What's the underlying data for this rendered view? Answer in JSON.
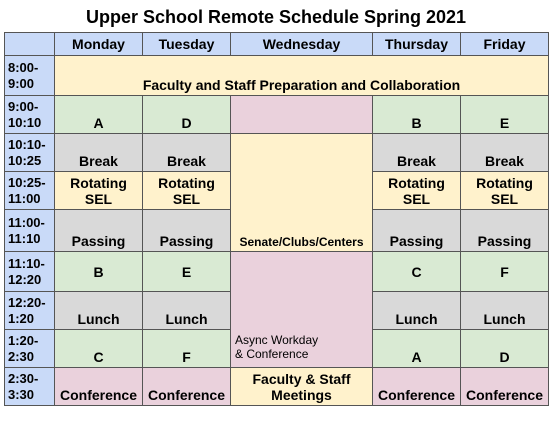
{
  "title": "Upper School Remote Schedule Spring 2021",
  "days": [
    "Monday",
    "Tuesday",
    "Wednesday",
    "Thursday",
    "Friday"
  ],
  "times": {
    "t0800": [
      "8:00-",
      "9:00"
    ],
    "t0900": [
      "9:00-",
      "10:10"
    ],
    "t1010": [
      "10:10-",
      "10:25"
    ],
    "t1025": [
      "10:25-",
      "11:00"
    ],
    "t1100": [
      "11:00-",
      "11:10"
    ],
    "t1110": [
      "11:10-",
      "12:20"
    ],
    "t1220": [
      "12:20-",
      "1:20"
    ],
    "t0120": [
      "1:20-",
      "2:30"
    ],
    "t0230": [
      "2:30-",
      "3:30"
    ]
  },
  "cells": {
    "prep": "Faculty and Staff Preparation and Collaboration",
    "mon_block1": "A",
    "tue_block1": "D",
    "thu_block1": "B",
    "fri_block1": "E",
    "break": "Break",
    "rotating": [
      "Rotating",
      "SEL"
    ],
    "passing": "Passing",
    "senate": "Senate/Clubs/Centers",
    "mon_block2": "B",
    "tue_block2": "E",
    "thu_block2": "C",
    "fri_block2": "F",
    "lunch": "Lunch",
    "async": [
      "Async Workday",
      "& Conference"
    ],
    "mon_block3": "C",
    "tue_block3": "F",
    "thu_block3": "A",
    "fri_block3": "D",
    "conference": "Conference",
    "meetings": [
      "Faculty & Staff",
      "Meetings"
    ]
  },
  "colors": {
    "header": "#c9daf8",
    "class_block": "#d9ead3",
    "break_block": "#d9d9d9",
    "prep_block": "#fff2cc",
    "conference_block": "#ead1dc"
  }
}
